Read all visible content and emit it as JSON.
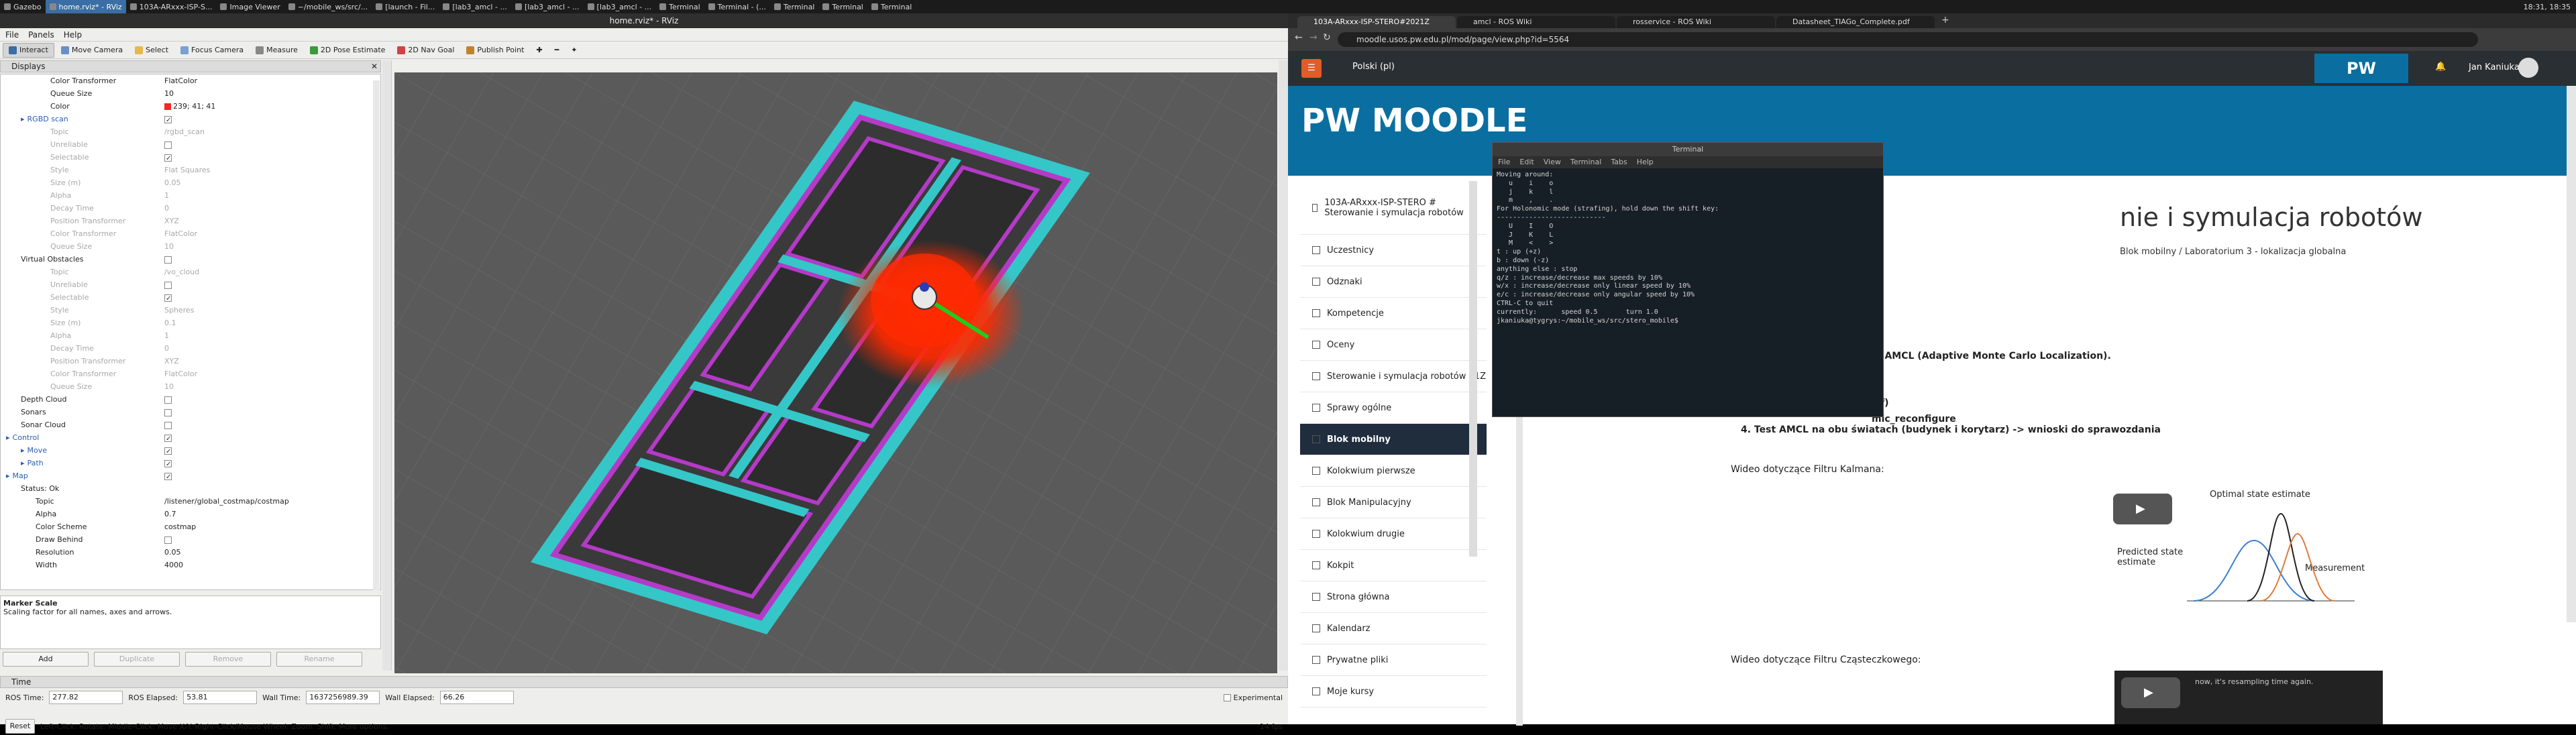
{
  "taskbar": {
    "items": [
      "Gazebo",
      "home.rviz* - RViz",
      "103A-ARxxx-ISP-S...",
      "Image Viewer",
      "~/mobile_ws/src/...",
      "[launch - Fil...",
      "[lab3_amcl - ...",
      "[lab3_amcl - ...",
      "[lab3_amcl - ...",
      "Terminal",
      "Terminal - (...",
      "Terminal",
      "Terminal",
      "Terminal"
    ],
    "active_index": 1,
    "clock": "18:31, 18:35"
  },
  "rviz": {
    "title": "home.rviz* - RViz",
    "menu": [
      "File",
      "Panels",
      "Help"
    ],
    "tools": [
      "Interact",
      "Move Camera",
      "Select",
      "Focus Camera",
      "Measure",
      "2D Pose Estimate",
      "2D Nav Goal",
      "Publish Point"
    ],
    "displays_title": "Displays",
    "rows": [
      {
        "k": "Color Transformer",
        "v": "FlatColor",
        "indent": 3,
        "dim": false
      },
      {
        "k": "Queue Size",
        "v": "10",
        "indent": 3,
        "dim": false
      },
      {
        "k": "Color",
        "v": "239; 41; 41",
        "indent": 3,
        "dim": false,
        "swatch": "#ef2929"
      },
      {
        "k": "RGBD scan",
        "v": "",
        "indent": 1,
        "dim": false,
        "check": true,
        "color": "#2a5db0"
      },
      {
        "k": "Topic",
        "v": "/rgbd_scan",
        "indent": 3,
        "dim": true
      },
      {
        "k": "Unreliable",
        "v": "",
        "indent": 3,
        "dim": true,
        "check": false
      },
      {
        "k": "Selectable",
        "v": "",
        "indent": 3,
        "dim": true,
        "check": true
      },
      {
        "k": "Style",
        "v": "Flat Squares",
        "indent": 3,
        "dim": true
      },
      {
        "k": "Size (m)",
        "v": "0.05",
        "indent": 3,
        "dim": true
      },
      {
        "k": "Alpha",
        "v": "1",
        "indent": 3,
        "dim": true
      },
      {
        "k": "Decay Time",
        "v": "0",
        "indent": 3,
        "dim": true
      },
      {
        "k": "Position Transformer",
        "v": "XYZ",
        "indent": 3,
        "dim": true
      },
      {
        "k": "Color Transformer",
        "v": "FlatColor",
        "indent": 3,
        "dim": true
      },
      {
        "k": "Queue Size",
        "v": "10",
        "indent": 3,
        "dim": true
      },
      {
        "k": "Virtual Obstacles",
        "v": "",
        "indent": 1,
        "dim": false,
        "check": false
      },
      {
        "k": "Topic",
        "v": "/vo_cloud",
        "indent": 3,
        "dim": true
      },
      {
        "k": "Unreliable",
        "v": "",
        "indent": 3,
        "dim": true,
        "check": false
      },
      {
        "k": "Selectable",
        "v": "",
        "indent": 3,
        "dim": true,
        "check": true
      },
      {
        "k": "Style",
        "v": "Spheres",
        "indent": 3,
        "dim": true
      },
      {
        "k": "Size (m)",
        "v": "0.1",
        "indent": 3,
        "dim": true
      },
      {
        "k": "Alpha",
        "v": "1",
        "indent": 3,
        "dim": true
      },
      {
        "k": "Decay Time",
        "v": "0",
        "indent": 3,
        "dim": true
      },
      {
        "k": "Position Transformer",
        "v": "XYZ",
        "indent": 3,
        "dim": true
      },
      {
        "k": "Color Transformer",
        "v": "FlatColor",
        "indent": 3,
        "dim": true
      },
      {
        "k": "Queue Size",
        "v": "10",
        "indent": 3,
        "dim": true
      },
      {
        "k": "Depth Cloud",
        "v": "",
        "indent": 1,
        "dim": false,
        "check": false
      },
      {
        "k": "Sonars",
        "v": "",
        "indent": 1,
        "dim": false,
        "check": false
      },
      {
        "k": "Sonar Cloud",
        "v": "",
        "indent": 1,
        "dim": false,
        "check": false
      },
      {
        "k": "Control",
        "v": "",
        "indent": 0,
        "dim": false,
        "check": true,
        "color": "#2a5db0"
      },
      {
        "k": "Move",
        "v": "",
        "indent": 1,
        "dim": false,
        "check": true,
        "color": "#2a5db0"
      },
      {
        "k": "Path",
        "v": "",
        "indent": 1,
        "dim": false,
        "check": true,
        "color": "#2a5db0"
      },
      {
        "k": "Map",
        "v": "",
        "indent": 0,
        "dim": false,
        "check": true,
        "color": "#2a5db0"
      },
      {
        "k": "Status: Ok",
        "v": "",
        "indent": 1,
        "dim": false
      },
      {
        "k": "Topic",
        "v": "/listener/global_costmap/costmap",
        "indent": 2,
        "dim": false
      },
      {
        "k": "Alpha",
        "v": "0.7",
        "indent": 2,
        "dim": false
      },
      {
        "k": "Color Scheme",
        "v": "costmap",
        "indent": 2,
        "dim": false
      },
      {
        "k": "Draw Behind",
        "v": "",
        "indent": 2,
        "dim": false,
        "check": false
      },
      {
        "k": "Resolution",
        "v": "0.05",
        "indent": 2,
        "dim": false
      },
      {
        "k": "Width",
        "v": "4000",
        "indent": 2,
        "dim": false
      }
    ],
    "description_title": "Marker Scale",
    "description_text": "Scaling factor for all names, axes and arrows.",
    "buttons": [
      "Add",
      "Duplicate",
      "Remove",
      "Rename"
    ],
    "time_title": "Time",
    "ros_time_label": "ROS Time:",
    "ros_time": "277.82",
    "ros_elapsed_label": "ROS Elapsed:",
    "ros_elapsed": "53.81",
    "wall_time_label": "Wall Time:",
    "wall_time": "1637256989.39",
    "wall_elapsed_label": "Wall Elapsed:",
    "wall_elapsed": "66.26",
    "experimental": "Experimental",
    "reset": "Reset",
    "hint": "Left-Click: Rotate. Middle-Click: Move X/Y. Right-Click/Mouse Wheel: Zoom. Shift: More options.",
    "fps": "14 fps"
  },
  "browser": {
    "tabs": [
      "103A-ARxxx-ISP-STERO#2021Z",
      "amcl - ROS Wiki",
      "rosservice - ROS Wiki",
      "Datasheet_TIAGo_Complete.pdf"
    ],
    "url": "moodle.usos.pw.edu.pl/mod/page/view.php?id=5564",
    "lang": "Polski (pl)",
    "user": "Jan Kaniuka",
    "logo": "PW MOODLE",
    "page_title": "nie i symulacja robotów",
    "breadcrumb_1": "Blok mobilny",
    "breadcrumb_2": "Laboratorium 3 - lokalizacja globalna",
    "sidebar": [
      "103A-ARxxx-ISP-STERO # Sterowanie i symulacja robotów",
      "Uczestnicy",
      "Odznaki",
      "Kompetencje",
      "Oceny",
      "Sterowanie i symulacja robotów 21Z",
      "Sprawy ogólne",
      "Blok mobilny",
      "Kolokwium pierwsze",
      "Blok Manipulacyjny",
      "Kolokwium drugie",
      "Kokpit",
      "Strona główna",
      "Kalendarz",
      "Prywatne pliki",
      "Moje kursy"
    ],
    "sidebar_selected": 7,
    "amcl_line": "m AMCL (Adaptive Monte Carlo Localization).",
    "tf_line": "(tf)",
    "reconf_line": "mic_reconfigure",
    "test_line": "4. Test AMCL na obu światach (budynek i korytarz) -> wnioski do sprawozdania",
    "kalman_label": "Wideo dotyczące Filtru Kalmana:",
    "particle_label": "Wideo dotyczące Filtru Cząsteczkowego:",
    "kalman_fig": {
      "optimal": "Optimal state estimate",
      "predicted": "Predicted state estimate",
      "measurement": "Measurement"
    },
    "video_caption": "now, it's resampling time again."
  },
  "terminal": {
    "title": "Terminal",
    "menu": [
      "File",
      "Edit",
      "View",
      "Terminal",
      "Tabs",
      "Help"
    ],
    "lines": [
      "Moving around:",
      "   u    i    o",
      "   j    k    l",
      "   m    ,    .",
      "",
      "For Holonomic mode (strafing), hold down the shift key:",
      "---------------------------",
      "   U    I    O",
      "   J    K    L",
      "   M    <    >",
      "",
      "t : up (+z)",
      "b : down (-z)",
      "",
      "anything else : stop",
      "",
      "q/z : increase/decrease max speeds by 10%",
      "w/x : increase/decrease only linear speed by 10%",
      "e/c : increase/decrease only angular speed by 10%",
      "",
      "CTRL-C to quit",
      "",
      "currently:      speed 0.5       turn 1.0",
      "jkaniuka@tygrys:~/mobile_ws/src/stero_mobile$ "
    ]
  },
  "colors": {
    "costmap_cyan": "#35c6c8",
    "costmap_magenta": "#b43ac8",
    "particles": "#ff2a00",
    "moodle_blue": "#0a6ea0"
  }
}
